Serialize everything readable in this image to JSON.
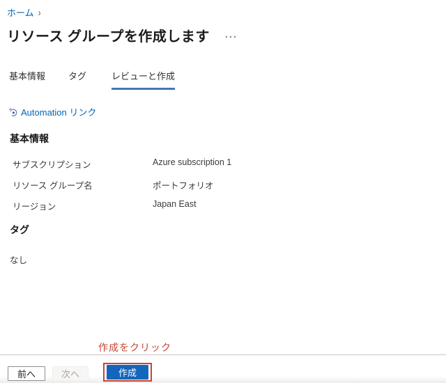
{
  "breadcrumb": {
    "home_label": "ホーム",
    "separator": "›"
  },
  "header": {
    "title": "リソース グループを作成します",
    "ellipsis_menu": "···"
  },
  "tabs": [
    {
      "label": "基本情報",
      "selected": false
    },
    {
      "label": "タグ",
      "selected": false
    },
    {
      "label": "レビューと作成",
      "selected": true
    }
  ],
  "automation_link": {
    "label": "Automation リンク"
  },
  "sections": {
    "basics": {
      "heading": "基本情報",
      "fields": [
        {
          "label": "サブスクリプション",
          "value": "Azure subscription 1"
        },
        {
          "label": "リソース グループ名",
          "value": "ポートフォリオ"
        },
        {
          "label": "リージョン",
          "value": "Japan East"
        }
      ]
    },
    "tags": {
      "heading": "タグ",
      "empty_value": "なし"
    }
  },
  "annotation": {
    "text": "作成をクリック"
  },
  "footer": {
    "previous_label": "前へ",
    "next_label": "次へ",
    "create_label": "作成"
  },
  "colors": {
    "link": "#0065b3",
    "tab_underline": "#4477b4",
    "primary_button": "#1266bb",
    "annotation_red": "#c54534"
  }
}
